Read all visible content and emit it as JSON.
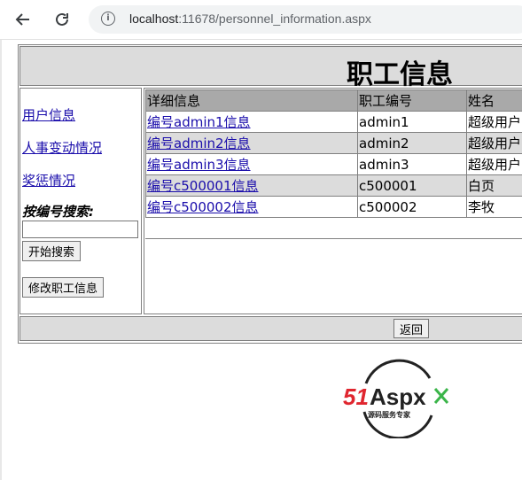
{
  "browser": {
    "url_host": "localhost",
    "url_rest": ":11678/personnel_information.aspx"
  },
  "page": {
    "title": "职工信息"
  },
  "sidebar": {
    "links": [
      {
        "label": "用户信息"
      },
      {
        "label": "人事变动情况"
      },
      {
        "label": "奖惩情况"
      }
    ],
    "search_label": "按编号搜索:",
    "search_value": "",
    "search_button": "开始搜索",
    "edit_button": "修改职工信息"
  },
  "table": {
    "headers": [
      "详细信息",
      "职工编号",
      "姓名"
    ],
    "rows": [
      {
        "detail": "编号admin1信息",
        "id": "admin1",
        "name": "超级用户"
      },
      {
        "detail": "编号admin2信息",
        "id": "admin2",
        "name": "超级用户"
      },
      {
        "detail": "编号admin3信息",
        "id": "admin3",
        "name": "超级用户"
      },
      {
        "detail": "编号c500001信息",
        "id": "c500001",
        "name": "白页"
      },
      {
        "detail": "编号c500002信息",
        "id": "c500002",
        "name": "李牧"
      }
    ]
  },
  "footer": {
    "back_button": "返回"
  },
  "logo": {
    "brand_a": "51",
    "brand_b": "Aspx",
    "tagline": "源码服务专家"
  },
  "colors": {
    "link": "#1a0dab",
    "header_bg": "#a9a9a9",
    "alt_row_bg": "#dcdcdc",
    "bar_bg": "#dcdcdc",
    "logo_red": "#e0262f",
    "logo_green": "#3bb54a"
  }
}
